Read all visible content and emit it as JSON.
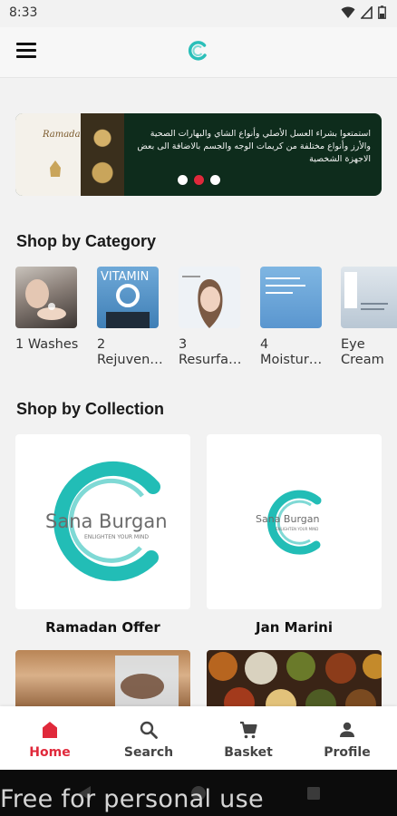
{
  "status_bar": {
    "time": "8:33"
  },
  "banner": {
    "script_title": "Ramadan Kareem",
    "arabic_text": "استمتعوا بشراء العسل الأصلي وأنواع الشاي والبهارات الصحية والأرز وأنواع مختلفة من كريمات الوجه والجسم بالاضافة الى بعض الاجهزة الشخصية",
    "dots": [
      false,
      true,
      false
    ]
  },
  "sections": {
    "category_title": "Shop by Category",
    "collection_title": "Shop by Collection"
  },
  "categories": [
    {
      "label": "1 Washes",
      "image": "washes-photo"
    },
    {
      "label": "2\nRejuven…",
      "image": "vitamin-c-photo",
      "thumb_text": "VITAMIN"
    },
    {
      "label": "3\nResurfa…",
      "image": "woman-face-photo"
    },
    {
      "label": "4\nMoistur…",
      "image": "moisturizer-photo"
    },
    {
      "label": "Eye\nCream",
      "image": "eye-cream-photo"
    }
  ],
  "collections": [
    {
      "name": "Ramadan Offer",
      "brand": "Sana Burgan",
      "tagline": "ENLIGHTEN YOUR MIND"
    },
    {
      "name": "Jan Marini",
      "brand": "Sana Burgan",
      "tagline": "ENLIGHTEN YOUR MIND"
    }
  ],
  "bottom_nav": [
    {
      "label": "Home",
      "icon": "home-icon",
      "active": true
    },
    {
      "label": "Search",
      "icon": "search-icon",
      "active": false
    },
    {
      "label": "Basket",
      "icon": "basket-icon",
      "active": false
    },
    {
      "label": "Profile",
      "icon": "profile-icon",
      "active": false
    }
  ],
  "watermark": "Free for personal use",
  "colors": {
    "accent": "#e0293b",
    "brand_teal": "#2bbfb9",
    "banner_green": "#0e2c1c"
  }
}
